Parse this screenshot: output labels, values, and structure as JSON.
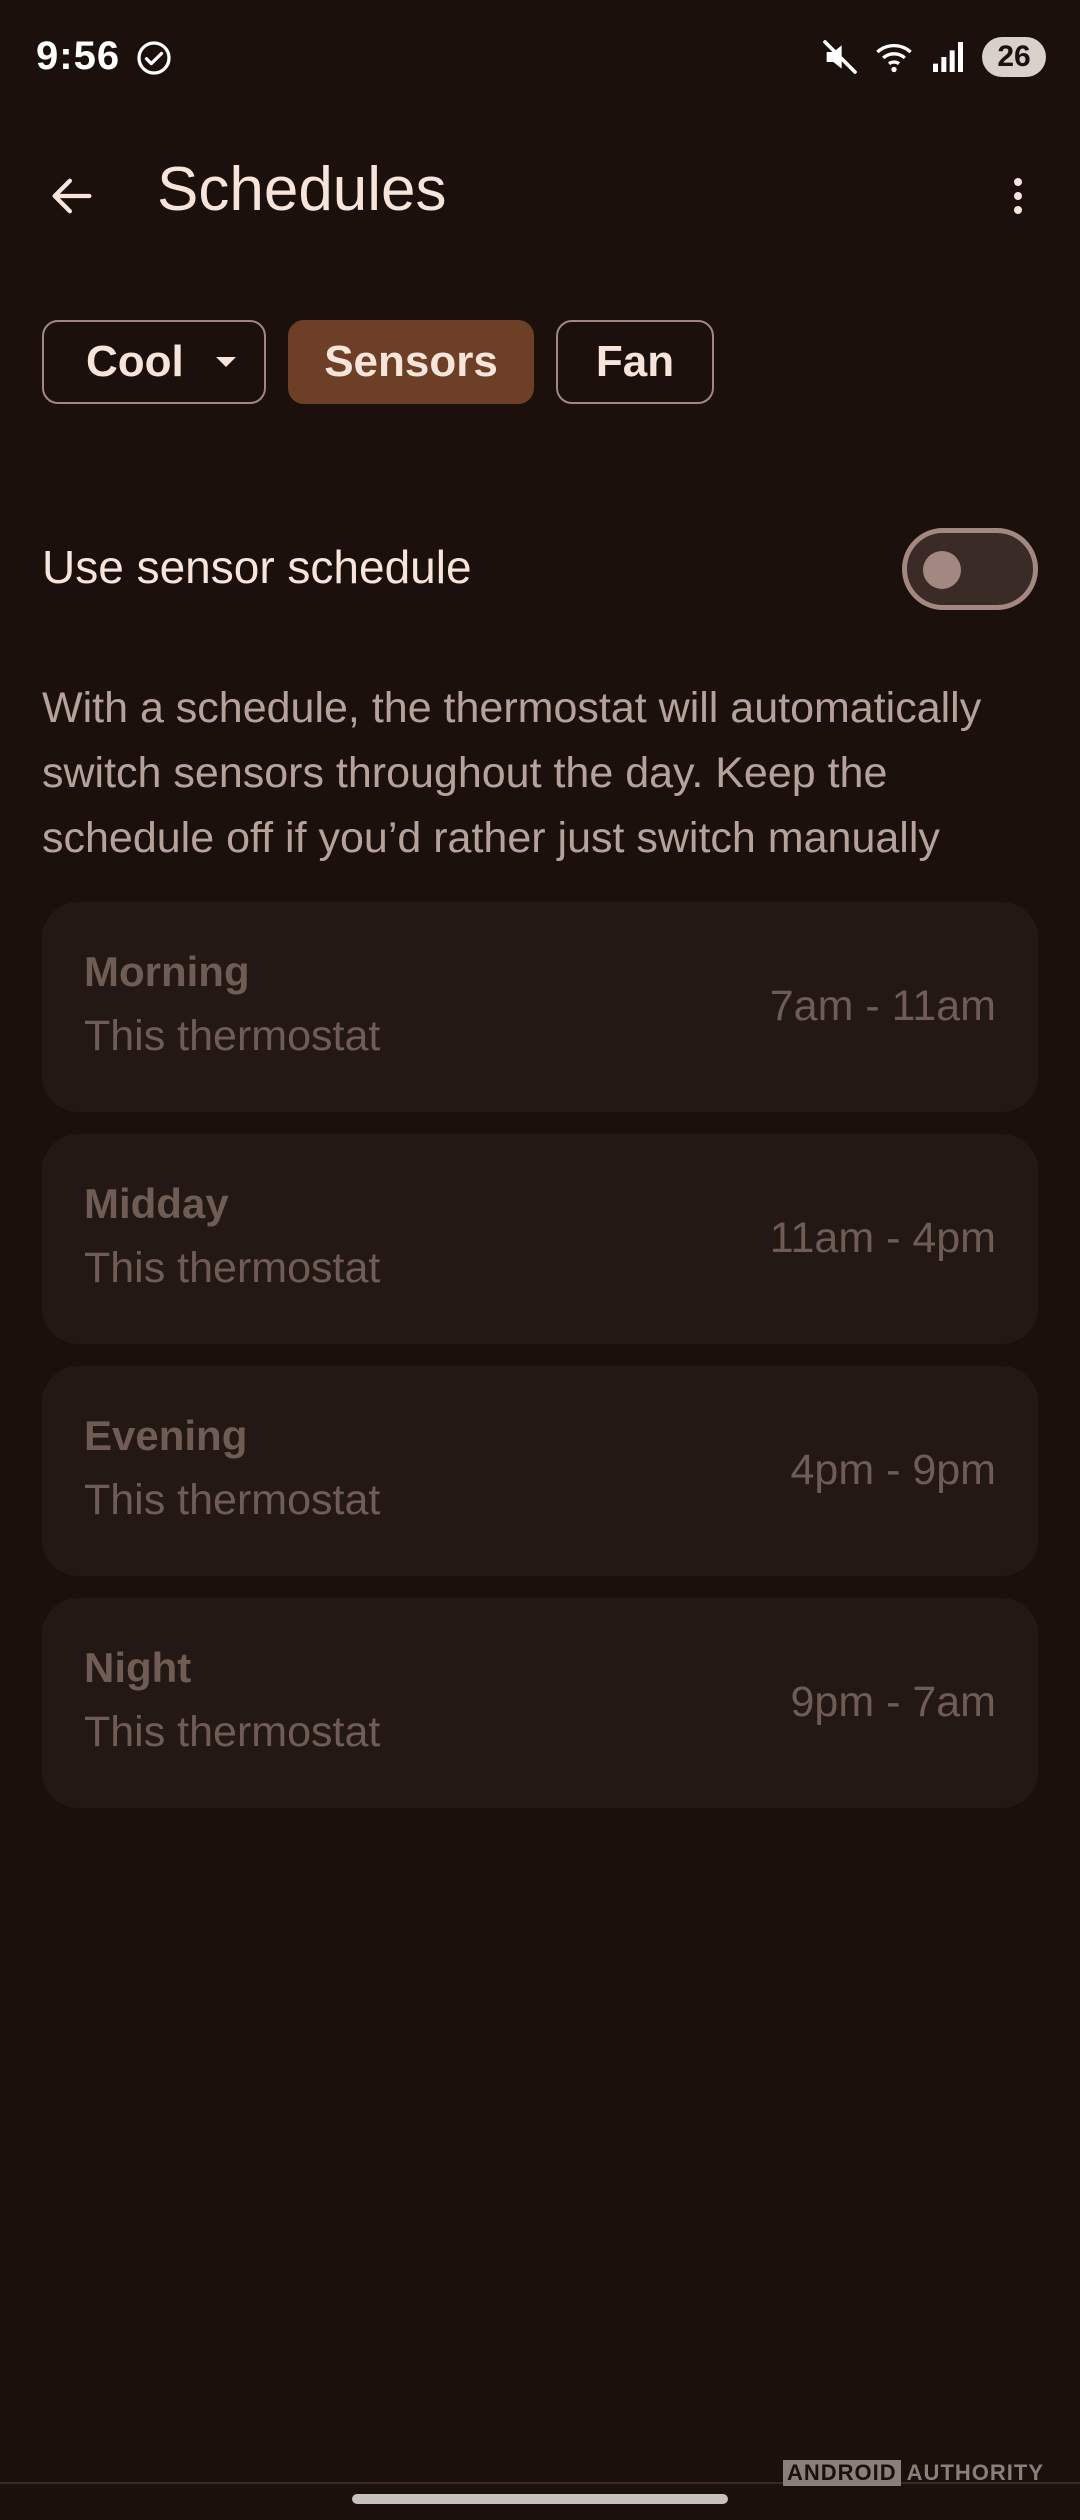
{
  "status_bar": {
    "time": "9:56",
    "battery": "26",
    "icons": [
      "check-circle-icon",
      "mute-icon",
      "wifi-icon",
      "signal-icon"
    ]
  },
  "app_bar": {
    "title": "Schedules",
    "back_icon": "arrow-back-icon",
    "more_icon": "more-vert-icon"
  },
  "chips": {
    "cool": "Cool",
    "sensors": "Sensors",
    "fan": "Fan",
    "selected": "sensors"
  },
  "toggle": {
    "label": "Use sensor schedule",
    "on": false
  },
  "description": "With a schedule, the thermostat will automatically switch sensors throughout the day. Keep the schedule off if you’d rather just switch manually",
  "schedules": [
    {
      "name": "Morning",
      "device": "This thermostat",
      "time": "7am - 11am"
    },
    {
      "name": "Midday",
      "device": "This thermostat",
      "time": "11am - 4pm"
    },
    {
      "name": "Evening",
      "device": "This thermostat",
      "time": "4pm - 9pm"
    },
    {
      "name": "Night",
      "device": "This thermostat",
      "time": "9pm - 7am"
    }
  ],
  "watermark": {
    "part1": "ANDROID",
    "part2": "AUTHORITY"
  },
  "colors": {
    "background": "#1c100c",
    "accent_chip": "#6d3f26",
    "card": "#241814",
    "muted_text": "#6e5c55"
  }
}
